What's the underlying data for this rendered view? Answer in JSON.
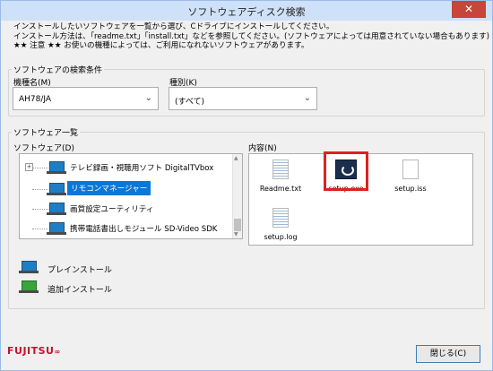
{
  "window": {
    "title": "ソフトウェアディスク検索",
    "close_glyph": "✕"
  },
  "intro": {
    "line1": "インストールしたいソフトウェアを一覧から選び、Cドライブにインストールしてください。",
    "line2": "インストール方法は、「readme.txt」「install.txt」などを参照してください。(ソフトウェアによっては用意されていない場合もあります)",
    "line3": "★★ 注意 ★★ お使いの機種によっては、ご利用になれないソフトウェアがあります。"
  },
  "search": {
    "group_label": "ソフトウェアの検索条件",
    "model_label": "機種名(M)",
    "model_value": "AH78/JA",
    "type_label": "種別(K)",
    "type_value": "(すべて)"
  },
  "list": {
    "group_label": "ソフトウェア一覧",
    "software_label": "ソフトウェア(D)",
    "content_label": "内容(N)",
    "tree": [
      {
        "label": "テレビ録画・視聴用ソフト DigitalTVbox",
        "expander": "+",
        "selected": false
      },
      {
        "label": "リモコンマネージャー",
        "expander": "",
        "selected": true
      },
      {
        "label": "画質設定ユーティリティ",
        "expander": "",
        "selected": false
      },
      {
        "label": "携帯電話書出しモジュール SD-Video SDK",
        "expander": "",
        "selected": false
      }
    ],
    "files": [
      {
        "name": "Readme.txt",
        "icon": "text-file-icon"
      },
      {
        "name": "setup.exe",
        "icon": "setup-exe-icon"
      },
      {
        "name": "setup.iss",
        "icon": "blank-file-icon"
      },
      {
        "name": "setup.log",
        "icon": "log-file-icon"
      }
    ]
  },
  "legend": {
    "preinstall": "プレインストール",
    "additional": "追加インストール"
  },
  "footer": {
    "logo_text": "FUJITSU",
    "close_button": "閉じる(C)"
  },
  "colors": {
    "selection": "#0a78d7",
    "highlight": "#e02020",
    "logo": "#c8102e",
    "preinstall_icon": "#1e7ec4",
    "additional_icon": "#3aa53a"
  }
}
